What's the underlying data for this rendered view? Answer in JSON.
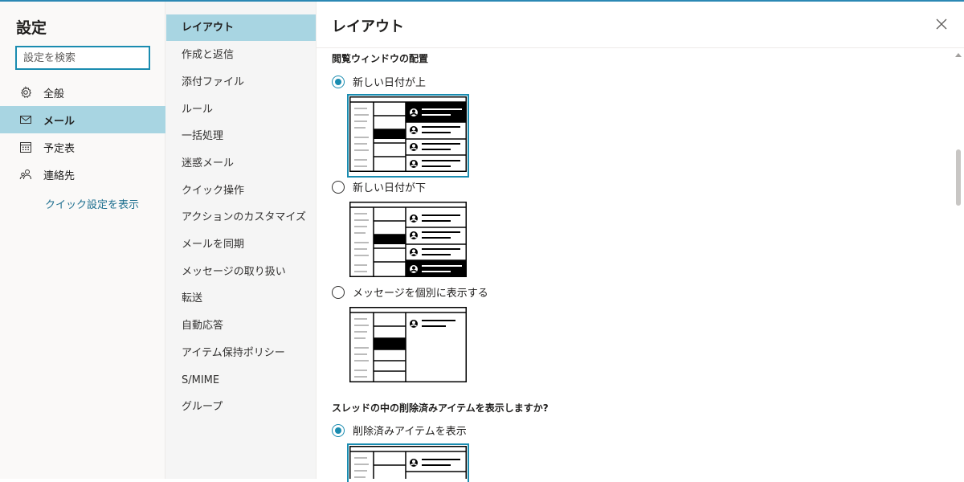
{
  "settings": {
    "title": "設定",
    "search_placeholder": "設定を検索",
    "categories": [
      {
        "label": "全般",
        "icon": "gear-icon",
        "selected": false
      },
      {
        "label": "メール",
        "icon": "mail-icon",
        "selected": true
      },
      {
        "label": "予定表",
        "icon": "calendar-icon",
        "selected": false
      },
      {
        "label": "連絡先",
        "icon": "people-icon",
        "selected": false
      }
    ],
    "quick_settings_link": "クイック設定を表示"
  },
  "mail_nav": {
    "items": [
      "レイアウト",
      "作成と返信",
      "添付ファイル",
      "ルール",
      "一括処理",
      "迷惑メール",
      "クイック操作",
      "アクションのカスタマイズ",
      "メールを同期",
      "メッセージの取り扱い",
      "転送",
      "自動応答",
      "アイテム保持ポリシー",
      "S/MIME",
      "グループ"
    ],
    "selected_index": 0
  },
  "content": {
    "title": "レイアウト",
    "reading_pane_section": "閲覧ウィンドウの配置",
    "options": [
      {
        "label": "新しい日付が上",
        "checked": true
      },
      {
        "label": "新しい日付が下",
        "checked": false
      },
      {
        "label": "メッセージを個別に表示する",
        "checked": false
      }
    ],
    "deleted_section": "スレッドの中の削除済みアイテムを表示しますか?",
    "deleted_options": [
      {
        "label": "削除済みアイテムを表示",
        "checked": true
      }
    ]
  },
  "colors": {
    "accent": "#1a8cb0",
    "selected_bg": "#a8d5e2",
    "link": "#1e6f8f"
  }
}
